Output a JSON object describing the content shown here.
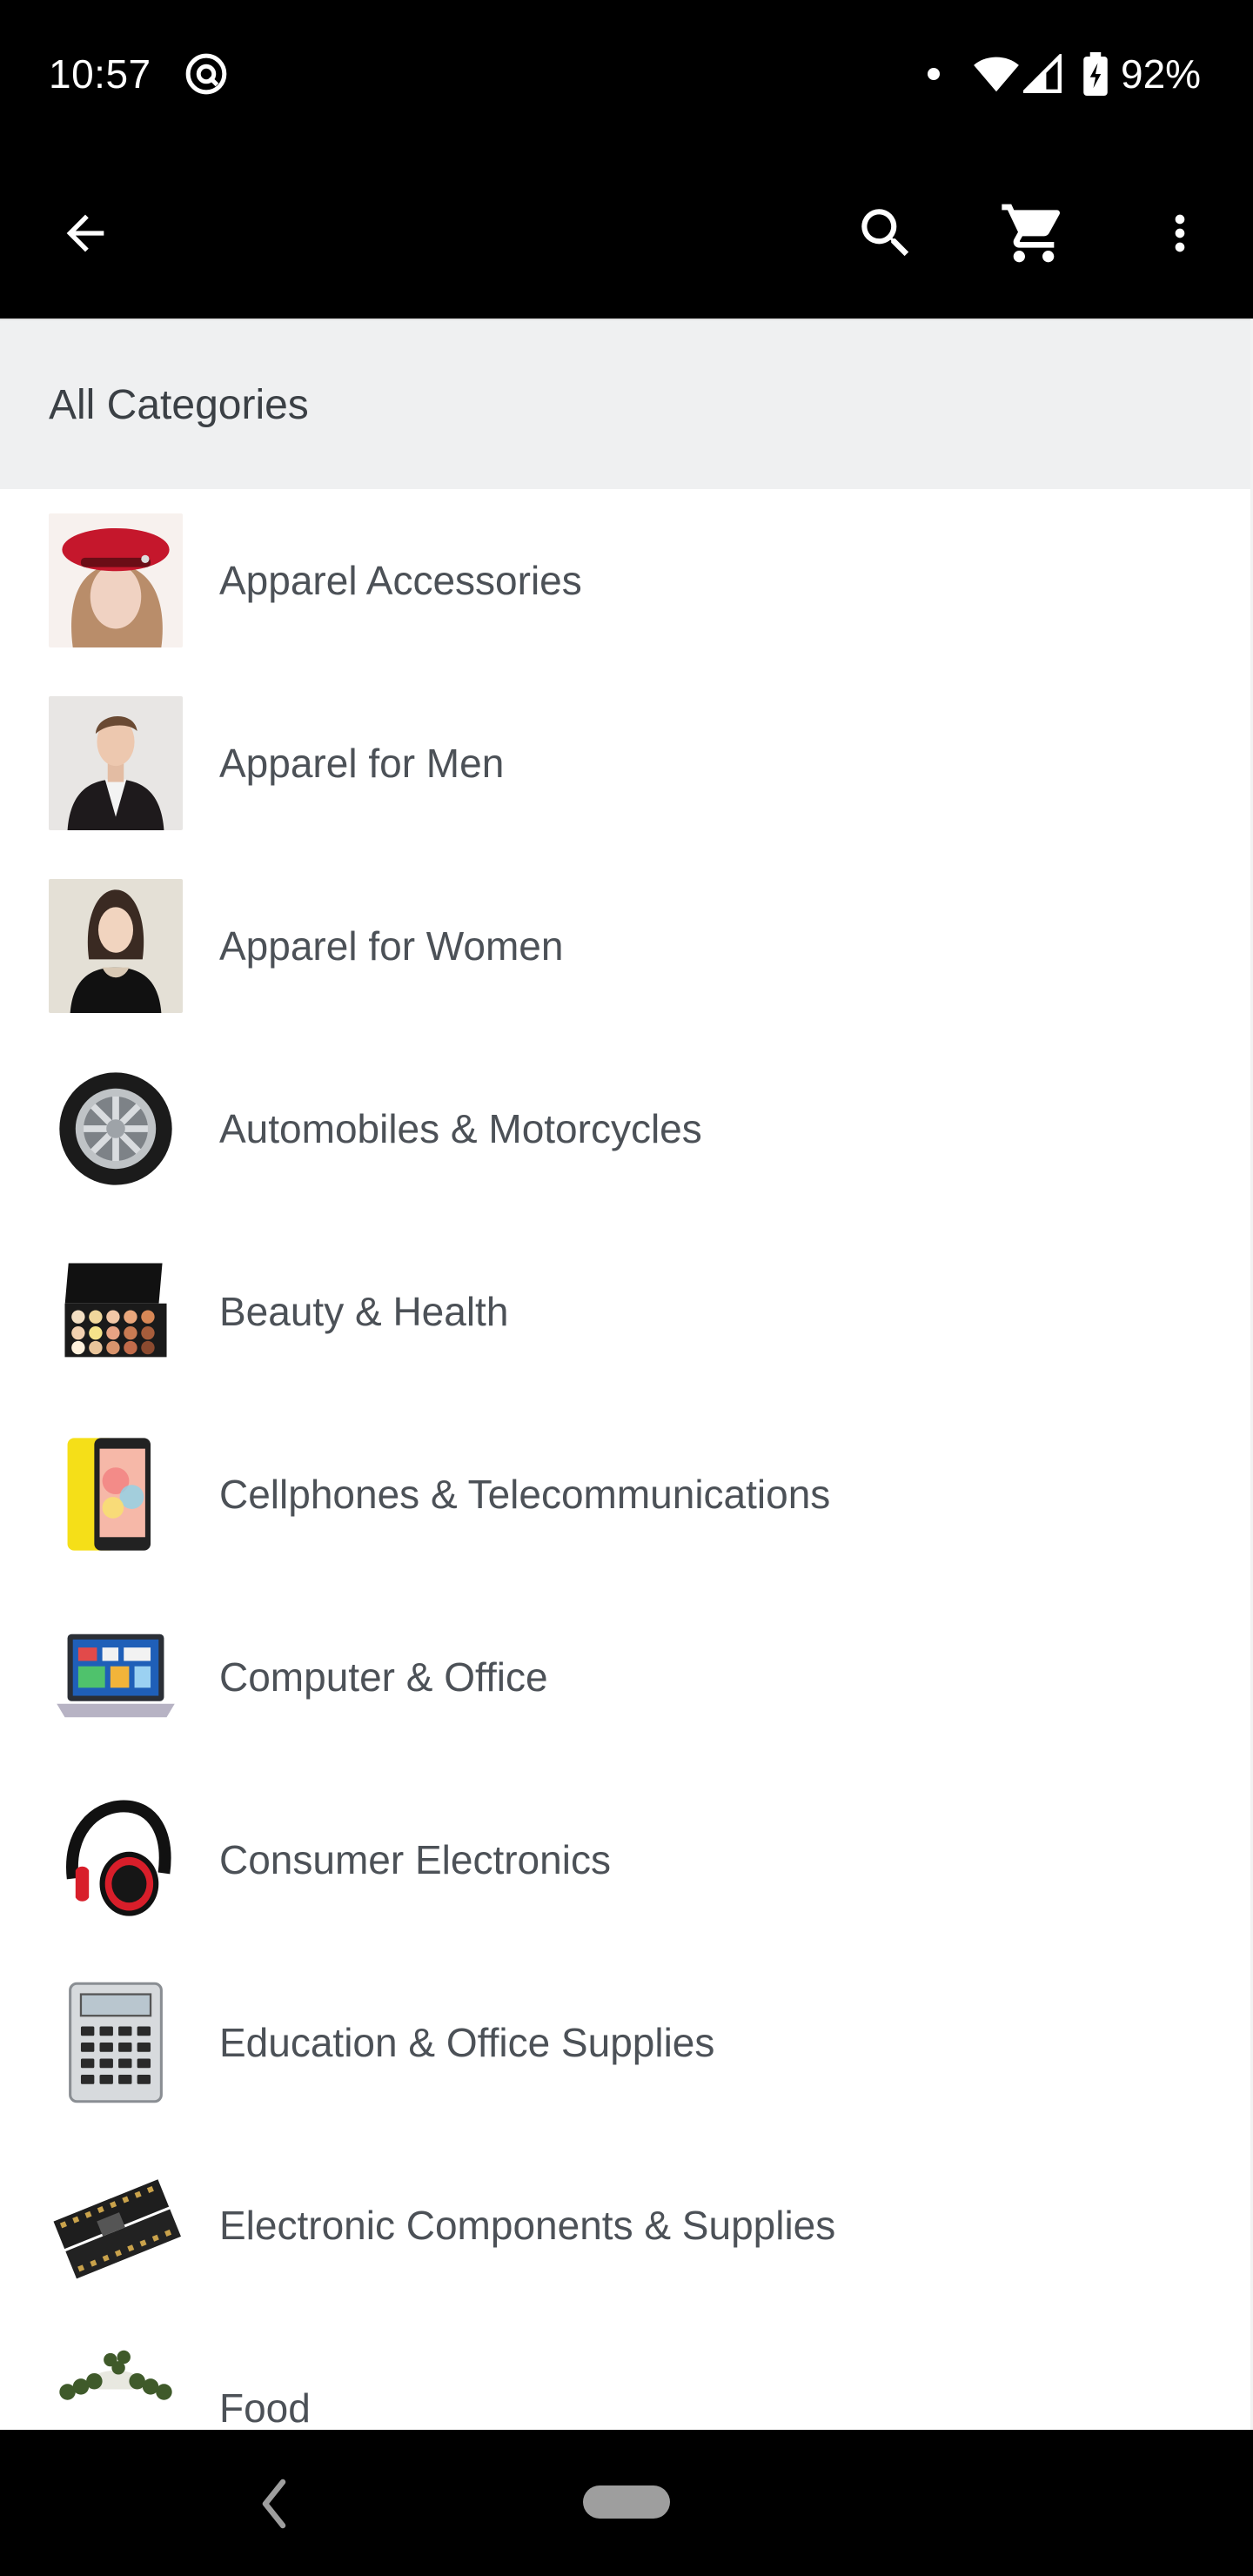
{
  "status_bar": {
    "time": "10:57",
    "battery_text": "92%"
  },
  "app_bar": {
    "icons": [
      "arrow-back-icon",
      "search-icon",
      "cart-icon",
      "more-vert-icon"
    ]
  },
  "section": {
    "title": "All Categories"
  },
  "categories": [
    {
      "label": "Apparel Accessories",
      "icon": "red-beret-hat-icon"
    },
    {
      "label": "Apparel for Men",
      "icon": "man-in-blazer-icon"
    },
    {
      "label": "Apparel for Women",
      "icon": "woman-in-black-top-icon"
    },
    {
      "label": "Automobiles & Motorcycles",
      "icon": "car-wheel-icon"
    },
    {
      "label": "Beauty & Health",
      "icon": "makeup-palette-icon"
    },
    {
      "label": "Cellphones & Telecommunications",
      "icon": "smartphone-icon"
    },
    {
      "label": "Computer & Office",
      "icon": "laptop-icon"
    },
    {
      "label": "Consumer Electronics",
      "icon": "headphones-icon"
    },
    {
      "label": "Education & Office Supplies",
      "icon": "calculator-icon"
    },
    {
      "label": "Electronic Components & Supplies",
      "icon": "circuit-board-icon"
    },
    {
      "label": "Food",
      "icon": "tea-leaves-icon"
    }
  ],
  "colors": {
    "bar_background": "#000000",
    "section_header_background": "#eff0f1",
    "list_background": "#ffffff",
    "text": "#4c5157"
  }
}
